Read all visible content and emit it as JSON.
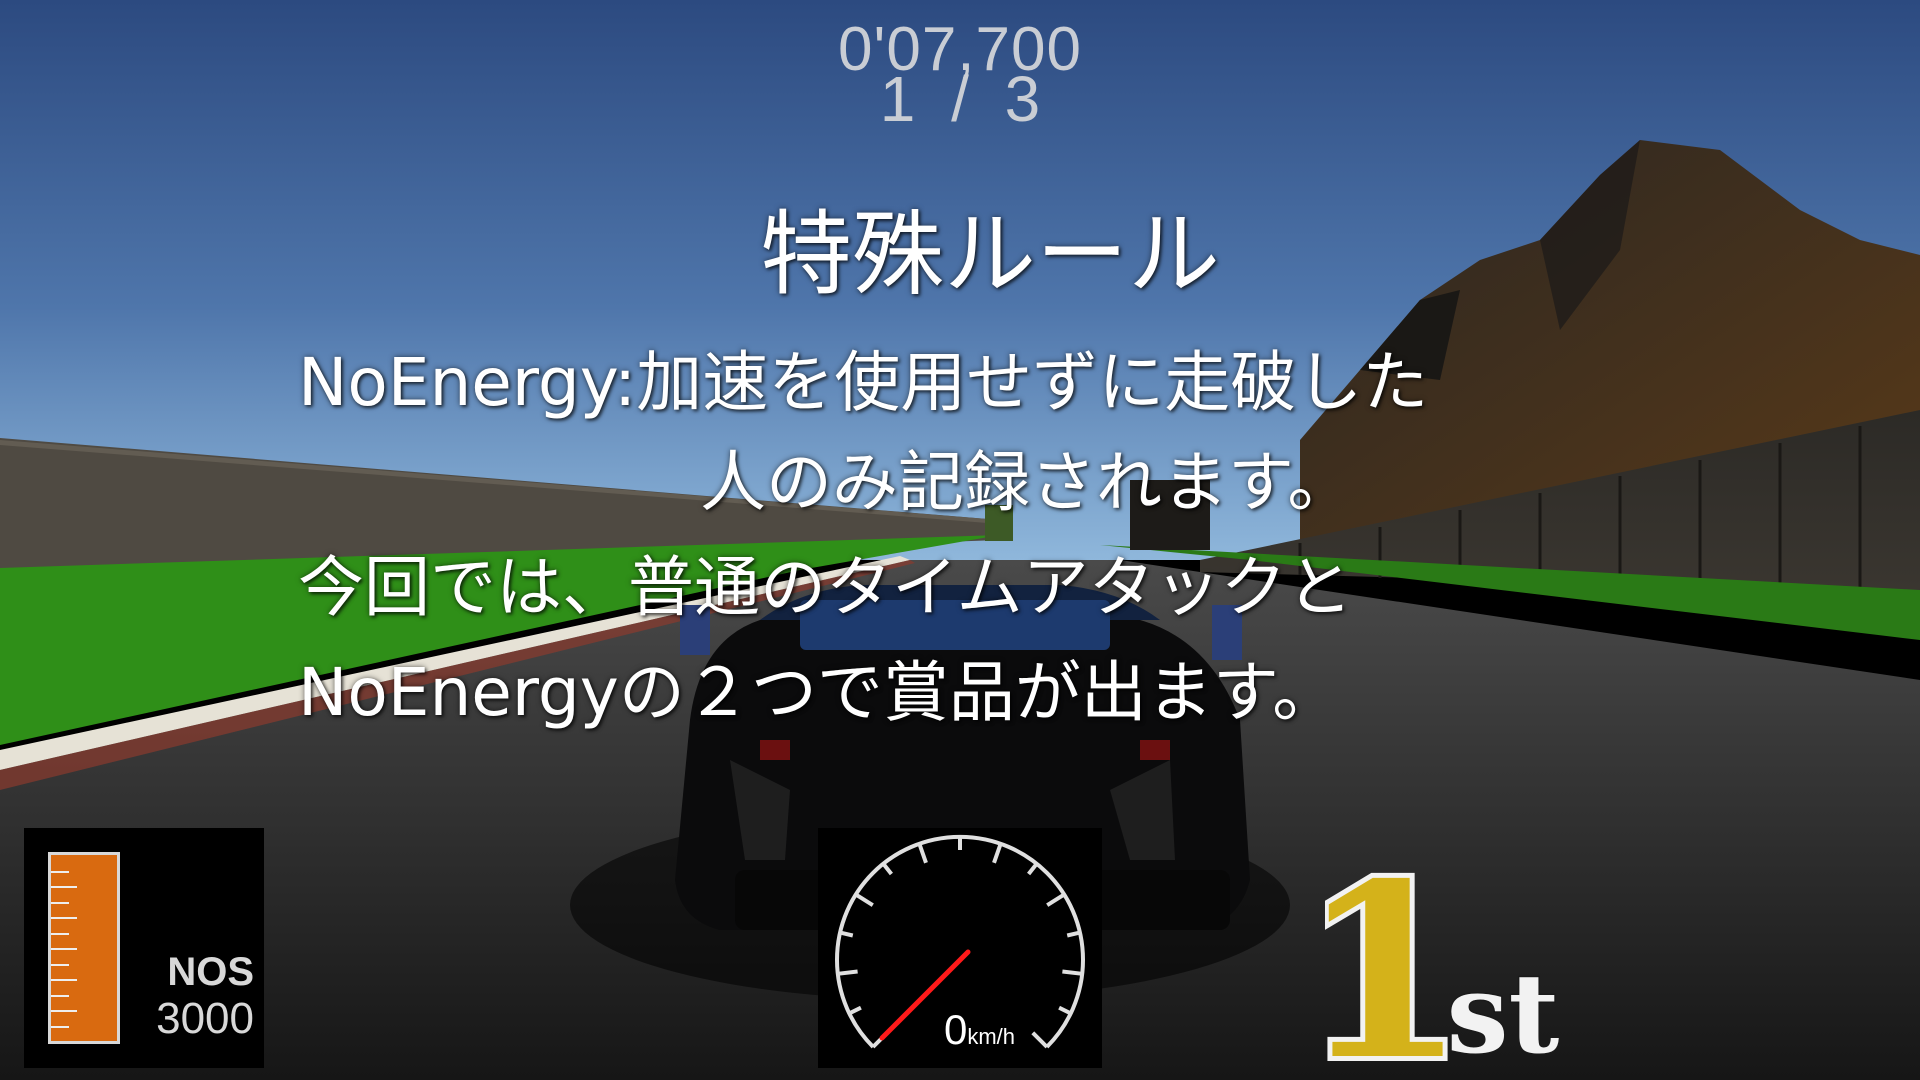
{
  "hud": {
    "lap_time": "0'07,700",
    "lap_current": "1",
    "lap_separator": "/",
    "lap_total": "3"
  },
  "rule": {
    "title": "特殊ルール",
    "lines": [
      "NoEnergy:加速を使用せずに走破した",
      "人のみ記録されます。",
      "今回では、普通のタイムアタックと",
      "NoEnergyの２つで賞品が出ます。"
    ]
  },
  "nos": {
    "label": "NOS",
    "value": "3000",
    "level": 1.0,
    "color": "#d96a10"
  },
  "speedometer": {
    "value": "0",
    "unit": "km/h",
    "needle_color": "#ff1a1a"
  },
  "position": {
    "number": "1",
    "suffix": "st",
    "color": "#d4b21a"
  },
  "colors": {
    "sky_top": "#2f4e85",
    "sky_bottom": "#7aa6d2",
    "grass": "#2f8f18",
    "road": "#1c1c1c",
    "mountain": "#2b2620"
  },
  "icons": [
    "race-car",
    "mountain-terrain"
  ]
}
